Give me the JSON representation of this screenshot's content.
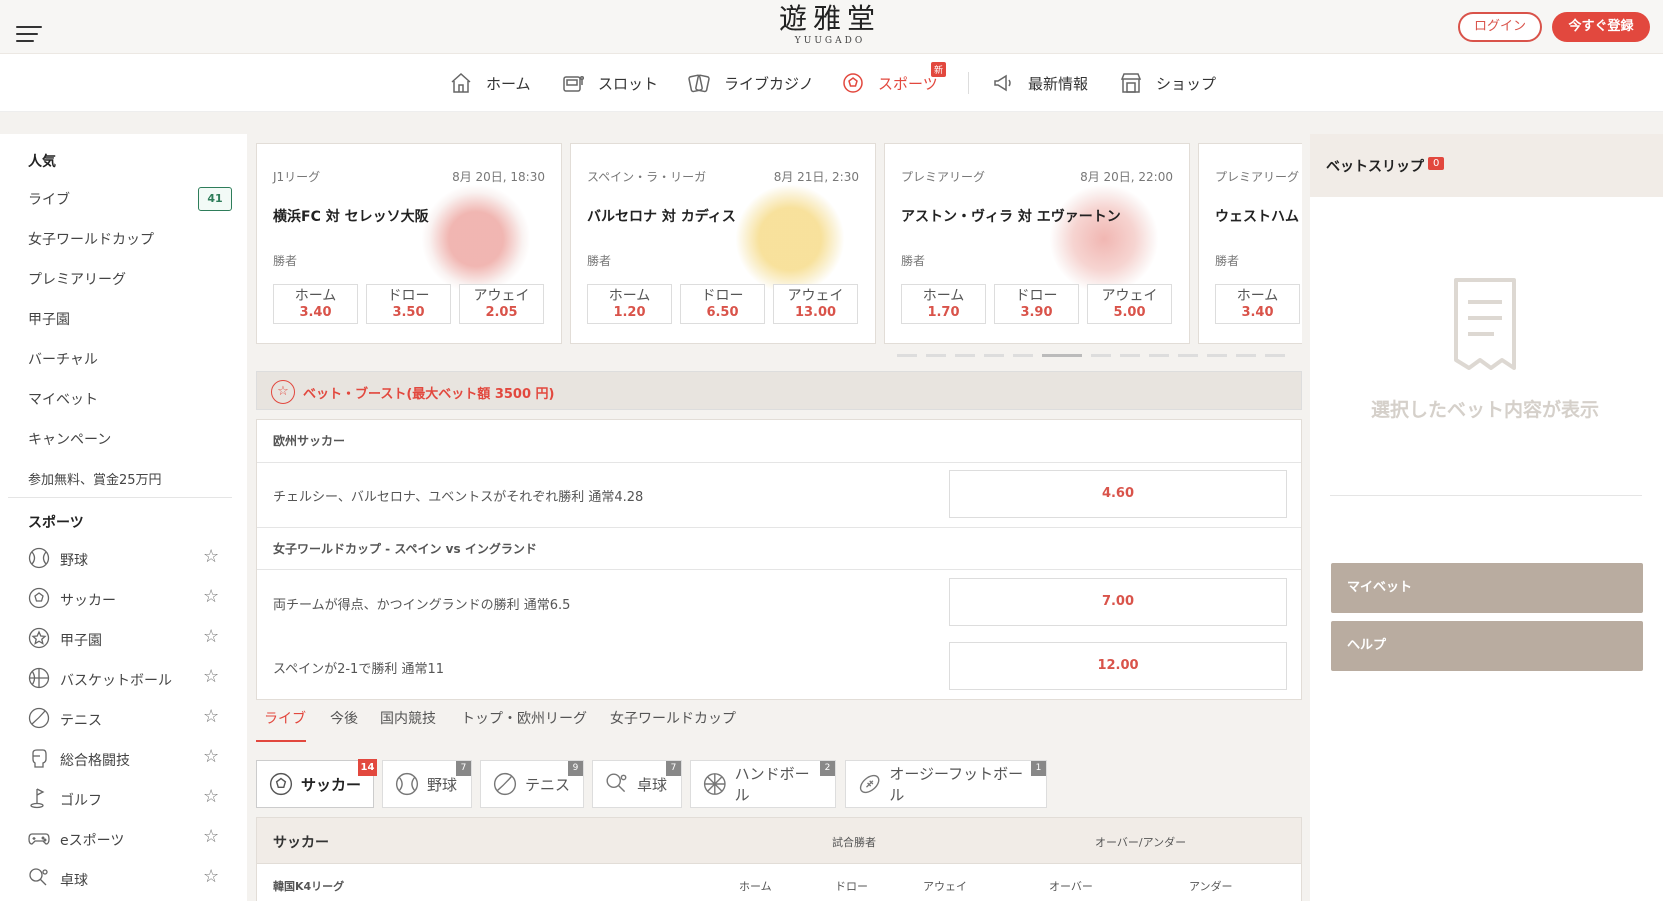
{
  "header": {
    "logo_kanji": "遊雅堂",
    "logo_roman": "YUUGADO",
    "login": "ログイン",
    "register": "今すぐ登録"
  },
  "nav": {
    "items": [
      {
        "label": "ホーム",
        "icon": "house-icon"
      },
      {
        "label": "スロット",
        "icon": "slot-machine-icon"
      },
      {
        "label": "ライブカジノ",
        "icon": "cards-icon"
      },
      {
        "label": "スポーツ",
        "icon": "soccer-ball-icon",
        "badge": "新"
      },
      {
        "label": "最新情報",
        "icon": "megaphone-icon"
      },
      {
        "label": "ショップ",
        "icon": "shop-icon"
      }
    ]
  },
  "sidebar": {
    "popular_title": "人気",
    "popular": [
      {
        "label": "ライブ",
        "badge": "41"
      },
      {
        "label": "女子ワールドカップ"
      },
      {
        "label": "プレミアリーグ"
      },
      {
        "label": "甲子園"
      },
      {
        "label": "バーチャル"
      },
      {
        "label": "マイベット"
      },
      {
        "label": "キャンペーン"
      },
      {
        "label": "参加無料、賞金25万円"
      }
    ],
    "sports_title": "スポーツ",
    "sports": [
      {
        "label": "野球",
        "icon": "baseball-icon"
      },
      {
        "label": "サッカー",
        "icon": "soccer-ball-icon"
      },
      {
        "label": "甲子園",
        "icon": "star-badge-icon"
      },
      {
        "label": "バスケットボール",
        "icon": "basketball-icon"
      },
      {
        "label": "テニス",
        "icon": "tennis-ball-icon"
      },
      {
        "label": "総合格闘技",
        "icon": "glove-icon"
      },
      {
        "label": "ゴルフ",
        "icon": "golf-icon"
      },
      {
        "label": "eスポーツ",
        "icon": "gamepad-icon"
      },
      {
        "label": "卓球",
        "icon": "table-tennis-icon"
      }
    ]
  },
  "cards": [
    {
      "league": "J1リーグ",
      "date": "8月 20日, 18:30",
      "match": "横浜FC 対 セレッソ大阪",
      "label": "勝者",
      "odds": [
        {
          "t": "ホーム",
          "v": "3.40"
        },
        {
          "t": "ドロー",
          "v": "3.50"
        },
        {
          "t": "アウェイ",
          "v": "2.05"
        }
      ],
      "color": "#e57b73"
    },
    {
      "league": "スペイン・ラ・リーガ",
      "date": "8月 21日, 2:30",
      "match": "バルセロナ 対 カディス",
      "label": "勝者",
      "odds": [
        {
          "t": "ホーム",
          "v": "1.20"
        },
        {
          "t": "ドロー",
          "v": "6.50"
        },
        {
          "t": "アウェイ",
          "v": "13.00"
        }
      ],
      "color": "#f2c94c"
    },
    {
      "league": "プレミアリーグ",
      "date": "8月 20日, 22:00",
      "match": "アストン・ヴィラ 対 エヴァートン",
      "label": "勝者",
      "odds": [
        {
          "t": "ホーム",
          "v": "1.70"
        },
        {
          "t": "ドロー",
          "v": "3.90"
        },
        {
          "t": "アウェイ",
          "v": "5.00"
        }
      ],
      "color": "#e57b73"
    },
    {
      "league": "プレミアリーグ",
      "date": "",
      "match": "ウェストハム",
      "label": "勝者",
      "odds": [
        {
          "t": "ホーム",
          "v": "3.40"
        }
      ],
      "color": "#e57b73"
    }
  ],
  "boost": {
    "title": "ベット・ブースト(最大ベット額 3500 円)",
    "groups": [
      {
        "head": "欧州サッカー",
        "rows": [
          {
            "text": "チェルシー、バルセロナ、ユベントスがそれぞれ勝利 通常4.28",
            "odd": "4.60"
          }
        ]
      },
      {
        "head": "女子ワールドカップ - スペイン vs イングランド",
        "rows": [
          {
            "text": "両チームが得点、かつイングランドの勝利 通常6.5",
            "odd": "7.00"
          },
          {
            "text": "スペインが2-1で勝利 通常11",
            "odd": "12.00"
          }
        ]
      }
    ]
  },
  "tabs": [
    "ライブ",
    "今後",
    "国内競技",
    "トップ・欧州リーグ",
    "女子ワールドカップ"
  ],
  "chips": [
    {
      "label": "サッカー",
      "count": "14",
      "icon": "soccer-ball-icon"
    },
    {
      "label": "野球",
      "count": "7",
      "icon": "baseball-icon"
    },
    {
      "label": "テニス",
      "count": "9",
      "icon": "tennis-ball-icon"
    },
    {
      "label": "卓球",
      "count": "7",
      "icon": "table-tennis-icon"
    },
    {
      "label": "ハンドボール",
      "count": "2",
      "icon": "handball-icon"
    },
    {
      "label": "オージーフットボール",
      "count": "1",
      "icon": "football-icon"
    }
  ],
  "table": {
    "title": "サッカー",
    "col_winner": "試合勝者",
    "col_ou": "オーバー/アンダー",
    "league": "韓国K4リーグ",
    "home": "ホーム",
    "draw": "ドロー",
    "away": "アウェイ",
    "over": "オーバー",
    "under": "アンダー"
  },
  "betslip": {
    "title": "ベットスリップ",
    "count": "0",
    "empty": "選択したベット内容が表示",
    "mybet": "マイベット",
    "help": "ヘルプ"
  },
  "colors": {
    "accent": "#e2483e",
    "beige": "#b9aca0",
    "green": "#2e7d5a"
  }
}
